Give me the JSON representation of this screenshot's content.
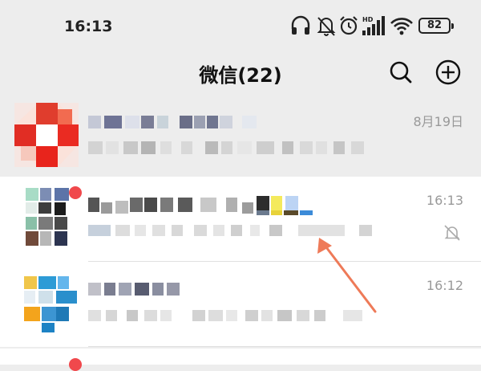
{
  "status_bar": {
    "time": "16:13",
    "battery": "82",
    "icons": [
      "headphones-icon",
      "bell-muted-icon",
      "alarm-icon",
      "hd-signal-icon",
      "wifi-icon",
      "battery-icon"
    ]
  },
  "header": {
    "title": "微信(22)",
    "search_icon": "search-icon",
    "add_icon": "plus-circle-icon"
  },
  "chats": [
    {
      "time": "8月19日",
      "pinned": true,
      "muted": false,
      "unread_dot": false
    },
    {
      "time": "16:13",
      "pinned": false,
      "muted": true,
      "unread_dot": true
    },
    {
      "time": "16:12",
      "pinned": false,
      "muted": false,
      "unread_dot": false
    }
  ],
  "colors": {
    "background": "#ededed",
    "row_bg": "#ffffff",
    "badge": "#f0484c",
    "arrow": "#ee7a58",
    "time_text": "#999999"
  }
}
